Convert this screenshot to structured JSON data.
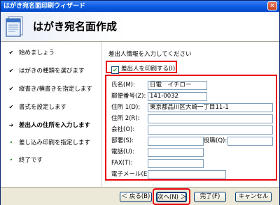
{
  "window": {
    "title": "はがき宛名面印刷ウィザード",
    "close_glyph": "✕"
  },
  "header": {
    "title": "はがき宛名面作成",
    "icon": "postcard-document-icon"
  },
  "sidebar": {
    "steps": [
      {
        "mark": "✔",
        "label": "始めましょう"
      },
      {
        "mark": "✔",
        "label": "はがきの種類を選びます"
      },
      {
        "mark": "✔",
        "label": "縦書き/横書きを指定します"
      },
      {
        "mark": "✔",
        "label": "書式を設定します"
      },
      {
        "mark": "➔",
        "label": "差出人の住所を入力します"
      },
      {
        "mark": "•",
        "label": "差し込み印刷を指定します"
      },
      {
        "mark": "•",
        "label": "終了です"
      }
    ]
  },
  "main": {
    "instruction": "差出人情報を入力してください",
    "print_sender": {
      "checked": true,
      "glyph": "✔",
      "label": "差出人を印刷する(I)"
    },
    "fields": {
      "name": {
        "label": "氏名(M):",
        "value": "日電　イチロー"
      },
      "postal": {
        "label": "郵便番号(Z):",
        "value": "141-0032"
      },
      "address1": {
        "label": "住所 1(D):",
        "value": "東京都品川区大崎一丁目11-1"
      },
      "address2": {
        "label": "住所 2(R):",
        "value": ""
      },
      "company": {
        "label": "会社(O):",
        "value": ""
      },
      "department": {
        "label": "部署(S):",
        "value": ""
      },
      "position": {
        "label": "役職(Q):",
        "value": ""
      },
      "phone": {
        "label": "電話(U):",
        "value": ""
      },
      "fax": {
        "label": "FAX(T):",
        "value": ""
      },
      "email": {
        "label": "電子メール(E):",
        "value": ""
      }
    }
  },
  "footer": {
    "back": "＜ 戻る(B)",
    "next": "次へ(N) ＞",
    "finish": "完了(F)",
    "cancel": "キャンセル"
  },
  "colors": {
    "highlight": "#e8000b",
    "title_bar": "#0a5be0",
    "future_step": "#1f8a2e"
  }
}
